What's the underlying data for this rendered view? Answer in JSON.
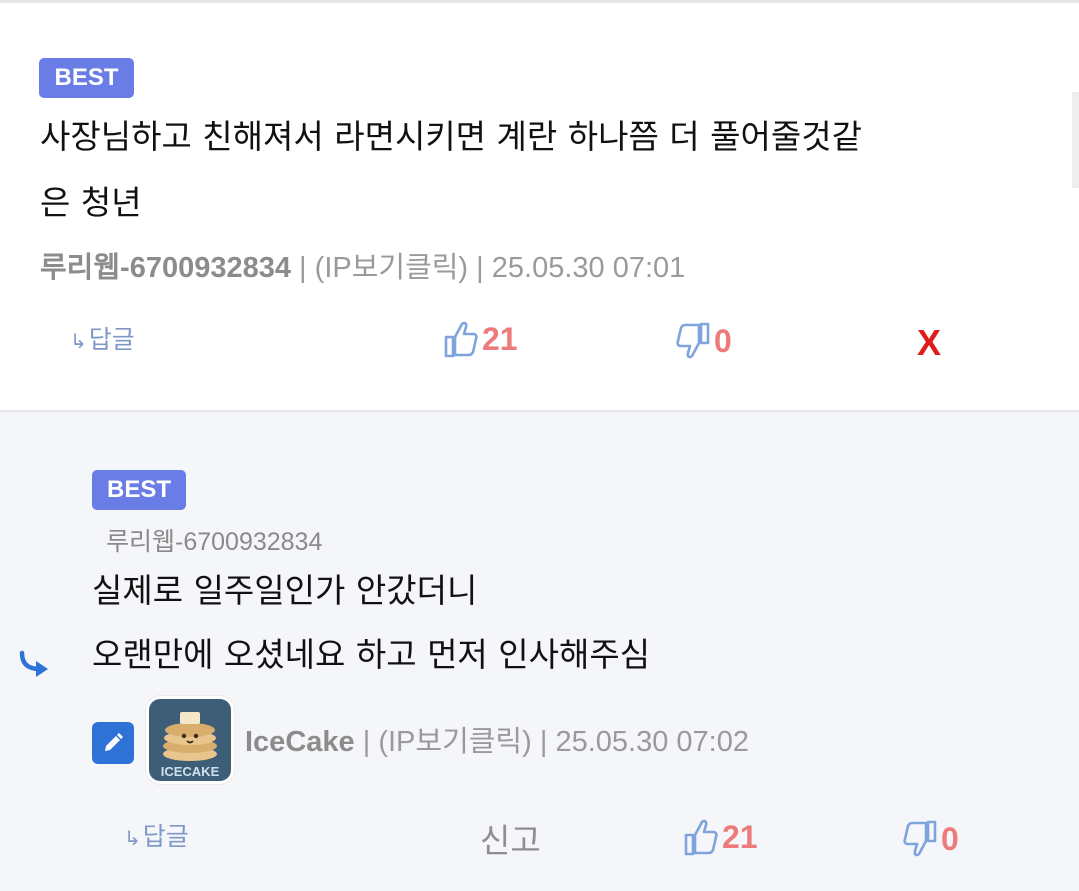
{
  "best_comment": {
    "badge": "BEST",
    "text_line1": "사장님하고 친해져서 라면시키면 계란 하나쯤 더 풀어줄것같",
    "text_line2": "은 청년",
    "author": "루리웹-6700932834",
    "ip_link": "(IP보기클릭)",
    "timestamp": "25.05.30 07:01",
    "separator": "|",
    "reply_label": "답글",
    "upvotes": "21",
    "downvotes": "0",
    "delete_label": "X"
  },
  "reply_comment": {
    "badge": "BEST",
    "parent_author": "루리웹-6700932834",
    "text_line1": "실제로 일주일인가 안갔더니",
    "text_line2": "오랜만에 오셨네요 하고 먼저 인사해주심",
    "author": "IceCake",
    "avatar_text": "ICECAKE",
    "ip_link": "(IP보기클릭)",
    "timestamp": "25.05.30 07:02",
    "separator": "|",
    "reply_label": "답글",
    "report_label": "신고",
    "upvotes": "21",
    "downvotes": "0"
  },
  "colors": {
    "badge_bg": "#6a7de7",
    "count_red": "#ee7b7b",
    "thumb_blue": "#7fa3dc",
    "delete_red": "#e01b1b",
    "reply_arrow_blue": "#2f72d6"
  },
  "icons": [
    "thumbs-up-icon",
    "thumbs-down-icon",
    "reply-arrow-icon",
    "pencil-icon"
  ]
}
